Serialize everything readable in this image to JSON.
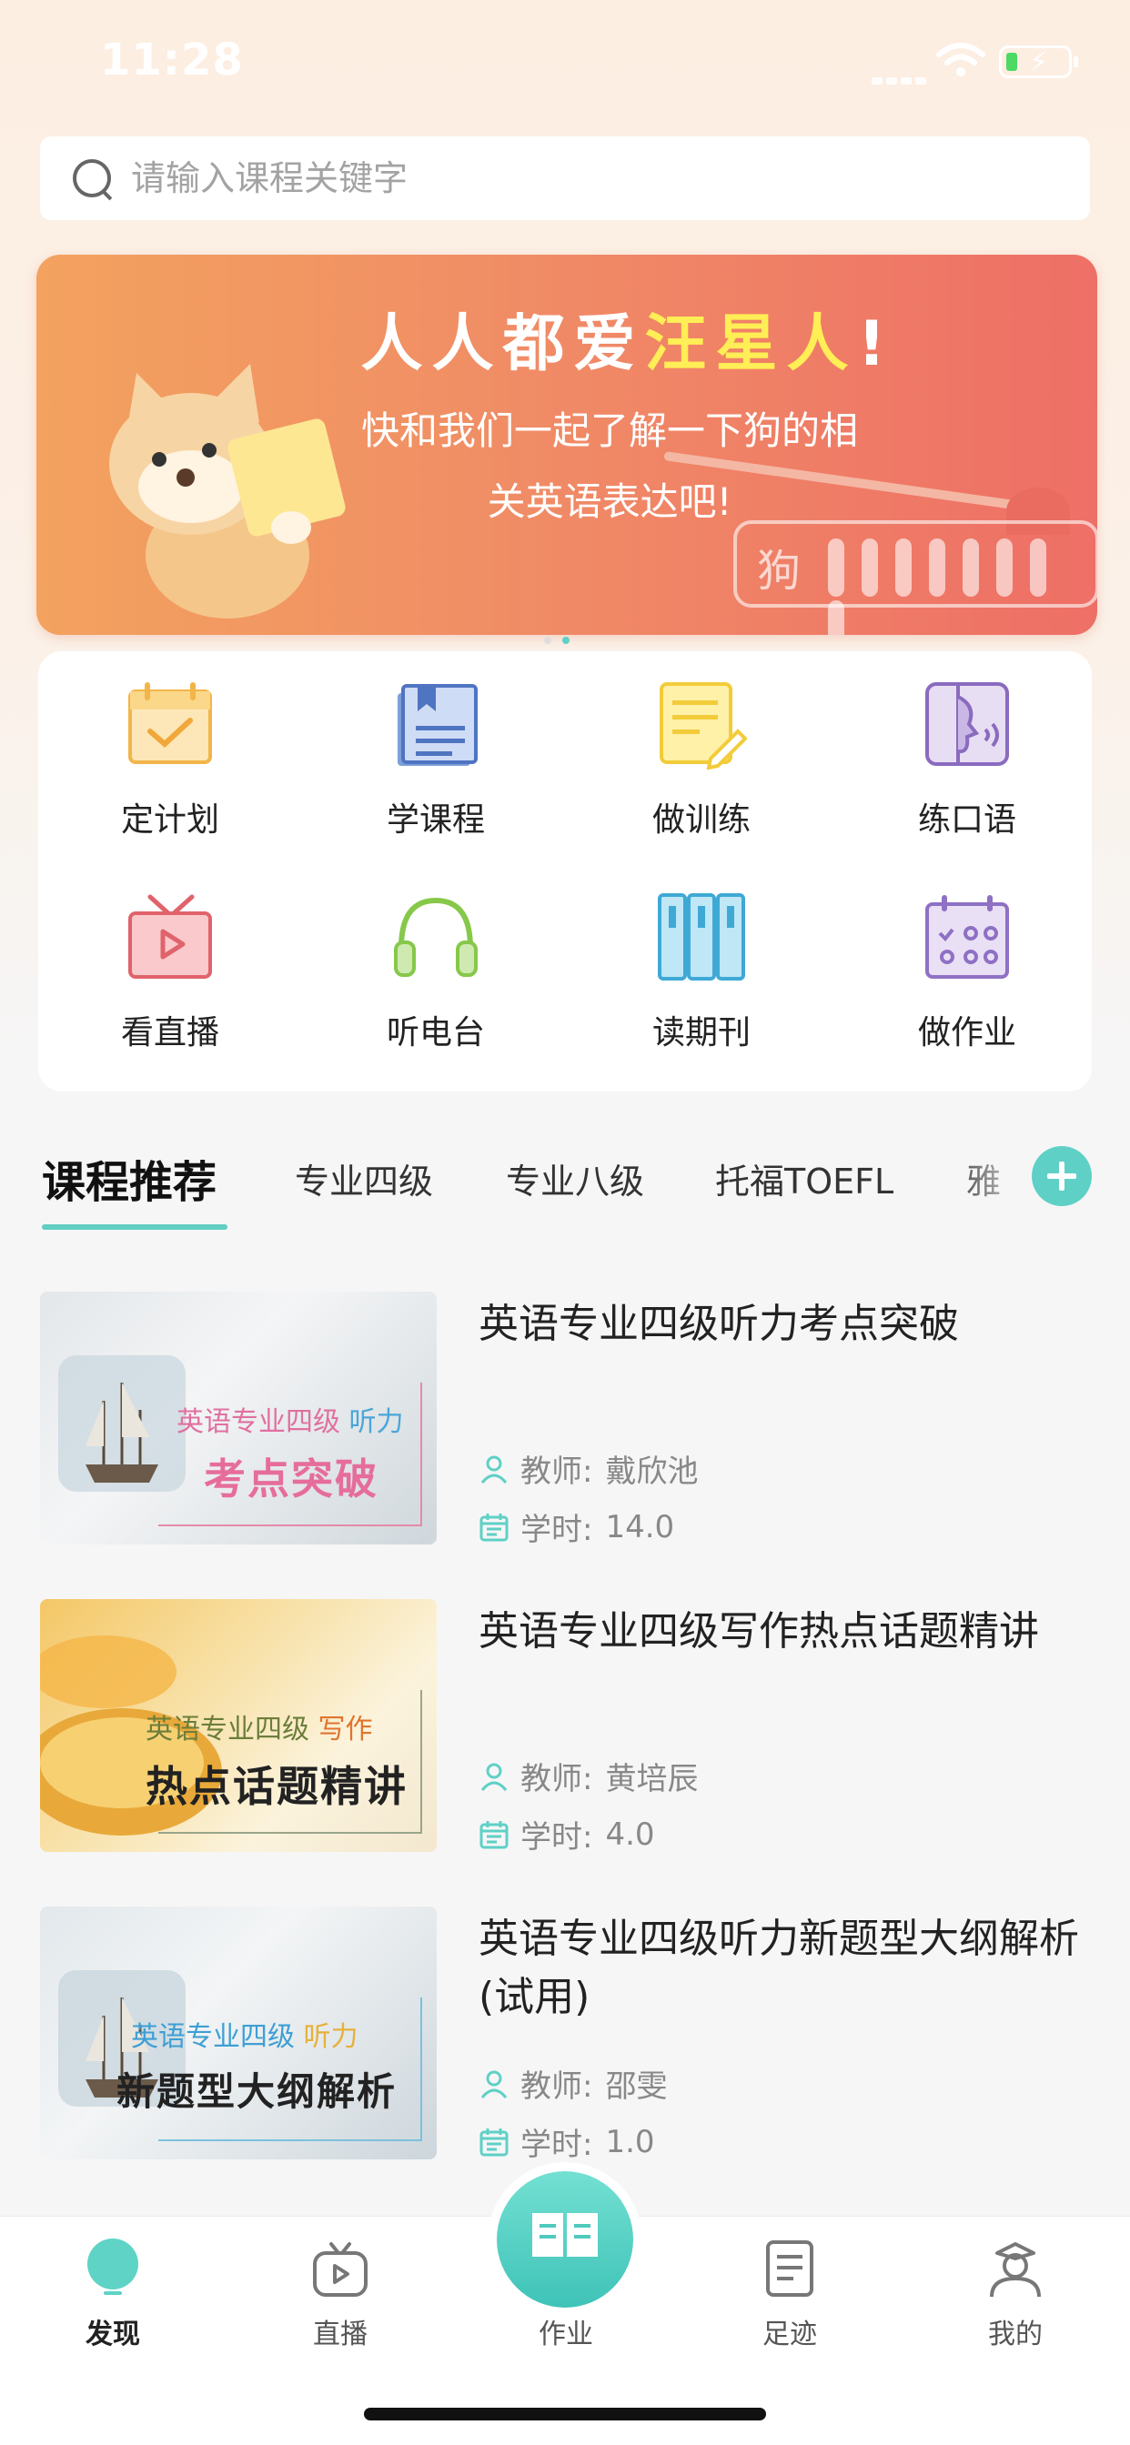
{
  "status_bar": {
    "time": "11:28"
  },
  "search": {
    "placeholder": "请输入课程关键字"
  },
  "banner": {
    "title_prefix": "人人都爱",
    "title_highlight": "汪星人",
    "title_suffix": "!",
    "line1": "快和我们一起了解一下狗的相",
    "line2": "关英语表达吧!",
    "box_char": "狗"
  },
  "features": [
    {
      "label": "定计划",
      "icon": "calendar-check-icon"
    },
    {
      "label": "学课程",
      "icon": "book-icon"
    },
    {
      "label": "做训练",
      "icon": "note-edit-icon"
    },
    {
      "label": "练口语",
      "icon": "speaking-face-icon"
    },
    {
      "label": "看直播",
      "icon": "tv-play-icon"
    },
    {
      "label": "听电台",
      "icon": "headphones-icon"
    },
    {
      "label": "读期刊",
      "icon": "binders-icon"
    },
    {
      "label": "做作业",
      "icon": "calendar-grid-icon"
    }
  ],
  "tabs": {
    "section_title": "课程推荐",
    "items": [
      "专业四级",
      "专业八级",
      "托福TOEFL",
      "雅"
    ]
  },
  "courses": [
    {
      "title": "英语专业四级听力考点突破",
      "teacher_label": "教师:",
      "teacher": "戴欣池",
      "hours_label": "学时:",
      "hours": "14.0",
      "thumb_sub": "英语专业四级",
      "thumb_sub_tag": "听力",
      "thumb_big": "考点突破"
    },
    {
      "title": "英语专业四级写作热点话题精讲",
      "teacher_label": "教师:",
      "teacher": "黄培辰",
      "hours_label": "学时:",
      "hours": "4.0",
      "thumb_sub": "英语专业四级",
      "thumb_sub_tag": "写作",
      "thumb_big": "热点话题精讲"
    },
    {
      "title": "英语专业四级听力新题型大纲解析 (试用)",
      "teacher_label": "教师:",
      "teacher": "邵雯",
      "hours_label": "学时:",
      "hours": "1.0",
      "thumb_sub": "英语专业四级",
      "thumb_sub_tag": "听力",
      "thumb_big": "新题型大纲解析"
    }
  ],
  "bottom_nav": {
    "items": [
      {
        "label": "发现",
        "icon": "bulb-icon",
        "active": true
      },
      {
        "label": "直播",
        "icon": "tv-icon"
      },
      {
        "label": "作业",
        "icon": "open-book-icon"
      },
      {
        "label": "足迹",
        "icon": "document-icon"
      },
      {
        "label": "我的",
        "icon": "profile-icon"
      }
    ]
  },
  "colors": {
    "accent": "#5fd0c6",
    "banner_start": "#f3a25f",
    "banner_end": "#ee6f66",
    "highlight": "#ffee55"
  }
}
